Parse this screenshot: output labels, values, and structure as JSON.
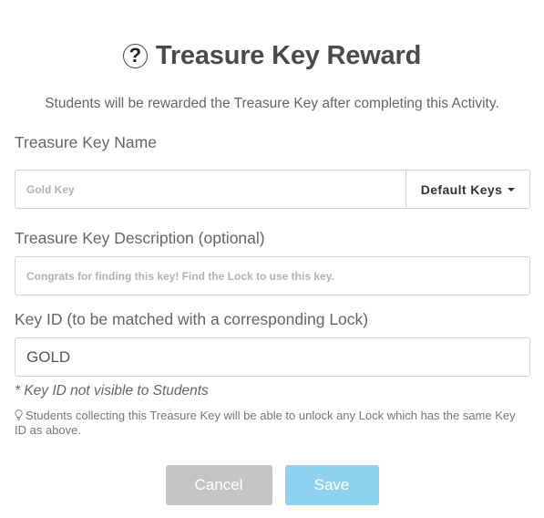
{
  "dialog": {
    "title": "Treasure Key Reward",
    "help_icon_glyph": "?",
    "subtitle": "Students will be rewarded the Treasure Key after completing this Activity."
  },
  "key_name": {
    "label": "Treasure Key Name",
    "placeholder": "Gold Key",
    "value": "",
    "dropdown_label": "Default Keys"
  },
  "key_description": {
    "label": "Treasure Key Description (optional)",
    "placeholder": "Congrats for finding this key! Find the Lock to use this key.",
    "value": ""
  },
  "key_id": {
    "label": "Key ID (to be matched with a corresponding Lock)",
    "value": "GOLD",
    "note": "* Key ID not visible to Students",
    "tip": "Students collecting this Treasure Key will be able to unlock any Lock which has the same Key ID as above."
  },
  "actions": {
    "cancel_label": "Cancel",
    "save_label": "Save"
  },
  "icons": {
    "help": "question-circle-icon",
    "tip": "lightbulb-icon",
    "dropdown": "caret-down-icon"
  },
  "colors": {
    "cancel_bg": "#c4c4c4",
    "save_bg": "#8fd3f1"
  }
}
